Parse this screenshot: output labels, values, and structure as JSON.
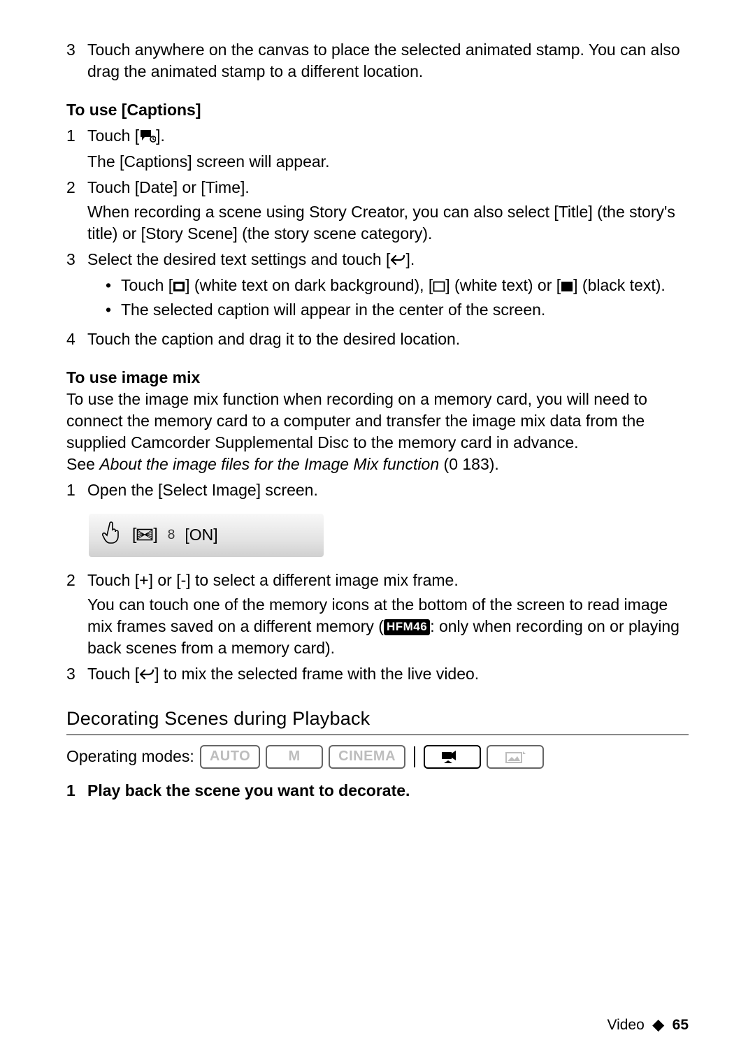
{
  "stamp_step": {
    "num": "3",
    "text": "Touch anywhere on the canvas to place the selected animated stamp. You can also drag the animated stamp to a different location."
  },
  "captions": {
    "heading": "To use [Captions]",
    "s1": {
      "num": "1",
      "line1a": "Touch [",
      "line1b": "].",
      "sub": "The [Captions] screen will appear."
    },
    "s2": {
      "num": "2",
      "line": "Touch [Date] or [Time].",
      "sub": "When recording a scene using Story Creator, you can also select [Title] (the story's title) or [Story Scene] (the story scene category)."
    },
    "s3": {
      "num": "3",
      "line_a": "Select the desired text settings and touch [",
      "line_b": "].",
      "b1a": "Touch [",
      "b1b": "] (white text on dark background), [",
      "b1c": "] (white text) or [",
      "b1d": "] (black text).",
      "b2": "The selected caption will appear in the center of the screen."
    },
    "s4": {
      "num": "4",
      "line": "Touch the caption and drag it to the desired location."
    }
  },
  "imagemix": {
    "heading": "To use image mix",
    "para_a": "To use the image mix function when recording on a memory card, you will need to connect the memory card to a computer and transfer the image mix data from the supplied Camcorder Supplemental Disc to the memory card in advance.",
    "see_a": "See ",
    "see_i": "About the image files for the Image Mix function",
    "see_b": " (0   183).",
    "s1": {
      "num": "1",
      "line": "Open the [Select Image] screen."
    },
    "bar": {
      "a_open": "[",
      "a_close": "]",
      "sep": "8",
      "b": "[ON]"
    },
    "s2": {
      "num": "2",
      "line": "Touch [+] or [-] to select a different image mix frame.",
      "sub_a": "You can touch one of the memory icons at the bottom of the screen to read image mix frames saved on a different memory (",
      "tag": "HFM46",
      "sub_b": ": only when recording on or playing back scenes from a memory card)."
    },
    "s3": {
      "num": "3",
      "a": "Touch [",
      "b": "] to mix the selected frame with the live video."
    }
  },
  "playback": {
    "heading": "Decorating Scenes during Playback",
    "modes_label": "Operating modes:",
    "modes": {
      "auto": "AUTO",
      "m": "M",
      "cinema": "CINEMA"
    },
    "s1": {
      "num": "1",
      "line": "Play back the scene you want to decorate."
    }
  },
  "footer": {
    "section": "Video",
    "dot": "◆",
    "page": "65"
  }
}
